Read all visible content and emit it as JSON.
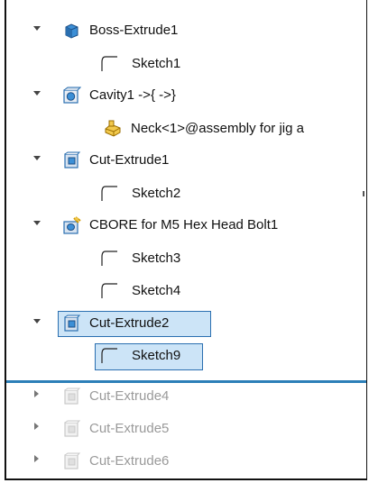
{
  "tree": {
    "items": [
      {
        "label": "Boss-Extrude1",
        "expanded": true,
        "icon": "boss-extrude-icon"
      },
      {
        "label": "Sketch1",
        "icon": "sketch-icon"
      },
      {
        "label": "Cavity1 ->{ ->}",
        "expanded": true,
        "icon": "cavity-icon"
      },
      {
        "label": "Neck<1>@assembly for jig a",
        "icon": "part-reference-icon"
      },
      {
        "label": "Cut-Extrude1",
        "expanded": true,
        "icon": "cut-extrude-icon"
      },
      {
        "label": "Sketch2",
        "icon": "sketch-icon"
      },
      {
        "label": "CBORE for M5 Hex Head Bolt1",
        "expanded": true,
        "icon": "hole-wizard-icon"
      },
      {
        "label": "Sketch3",
        "icon": "sketch-icon"
      },
      {
        "label": "Sketch4",
        "icon": "sketch-icon"
      },
      {
        "label": "Cut-Extrude2",
        "expanded": true,
        "selected": true,
        "icon": "cut-extrude-icon"
      },
      {
        "label": "Sketch9",
        "selected": true,
        "icon": "sketch-icon"
      },
      {
        "label": "Cut-Extrude4",
        "expanded": false,
        "suppressed": true,
        "icon": "cut-extrude-icon"
      },
      {
        "label": "Cut-Extrude5",
        "expanded": false,
        "suppressed": true,
        "icon": "cut-extrude-icon"
      },
      {
        "label": "Cut-Extrude6",
        "expanded": false,
        "suppressed": true,
        "icon": "cut-extrude-icon"
      }
    ]
  },
  "colors": {
    "selection_fill": "#cce4f7",
    "selection_border": "#2a6fb0",
    "rollback_bar": "#2c7fb8",
    "suppressed_text": "#9a9a9a"
  }
}
